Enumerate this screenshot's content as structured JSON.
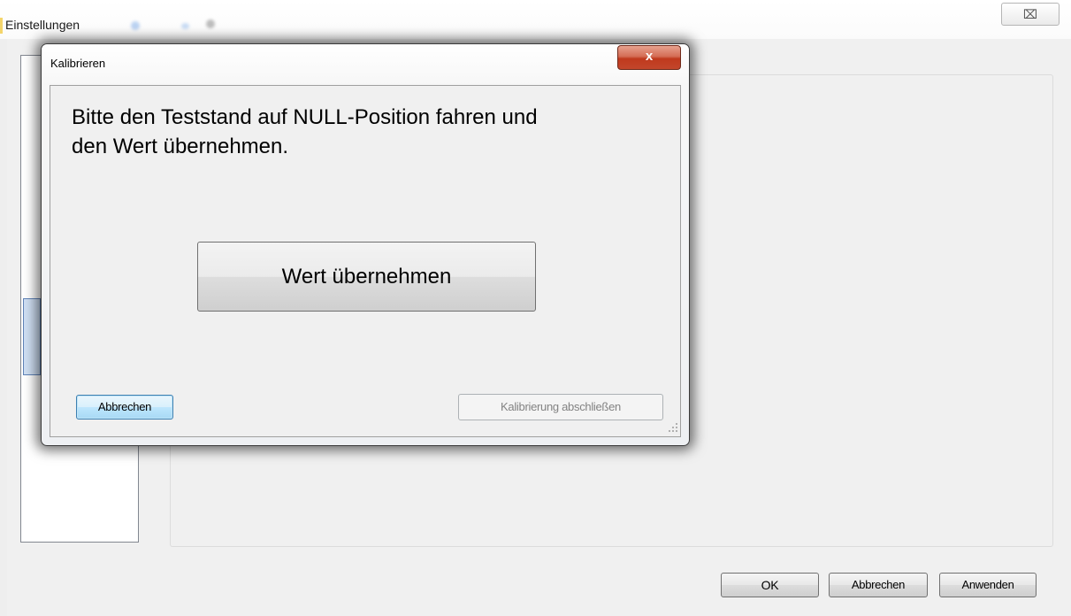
{
  "main_window": {
    "title": "Einstellungen",
    "close_glyph": "⌧",
    "buttons": {
      "ok": "OK",
      "cancel": "Abbrechen",
      "apply": "Anwenden"
    }
  },
  "dialog": {
    "title": "Kalibrieren",
    "close_glyph": "x",
    "instruction": "Bitte den Teststand auf NULL-Position fahren und\nden Wert übernehmen.",
    "accept_value_label": "Wert übernehmen",
    "cancel_label": "Abbrechen",
    "finish_label": "Kalibrierung abschließen",
    "finish_enabled": false
  },
  "icons": {
    "main_close": "close-icon",
    "dialog_close": "close-icon",
    "resize_grip": "resize-grip-icon"
  },
  "colors": {
    "dialog_close_red": "#c0391d",
    "focused_button_border": "#3c7fb1",
    "window_background": "#f0f0f0",
    "disabled_text": "#838383"
  }
}
